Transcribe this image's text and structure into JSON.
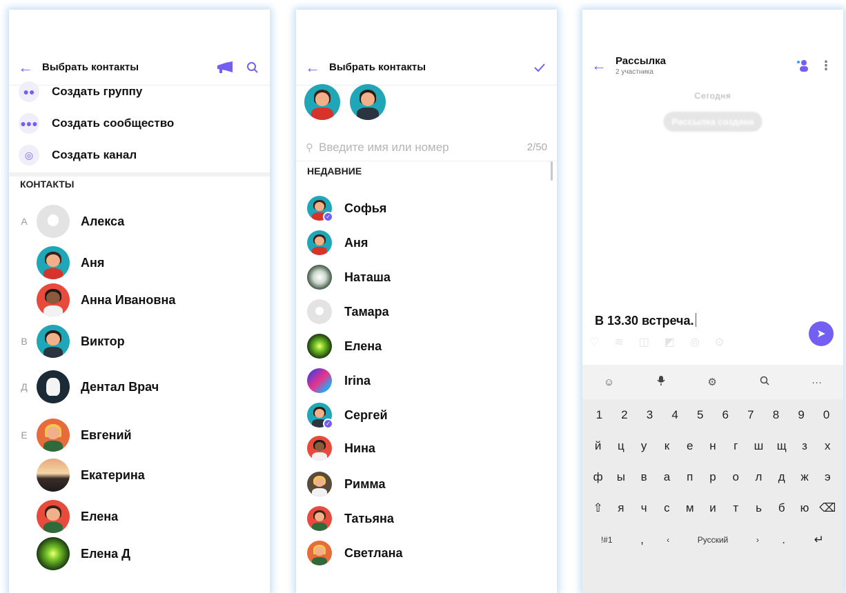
{
  "screen1": {
    "header": {
      "title": "Выбрать контакты",
      "back_icon": "arrow-left-icon",
      "broadcast_icon": "megaphone-icon",
      "search_icon": "search-icon"
    },
    "actions": [
      {
        "label": "Создать группу",
        "icon": "group-icon"
      },
      {
        "label": "Создать сообщество",
        "icon": "community-icon"
      },
      {
        "label": "Создать канал",
        "icon": "channel-icon"
      }
    ],
    "section_title": "КОНТАКТЫ",
    "contacts": [
      {
        "letter": "А",
        "name": "Алекса"
      },
      {
        "letter": "",
        "name": "Аня"
      },
      {
        "letter": "",
        "name": "Анна Ивановна"
      },
      {
        "letter": "В",
        "name": "Виктор"
      },
      {
        "letter": "Д",
        "name": "Дентал Врач"
      },
      {
        "letter": "Е",
        "name": "Евгений"
      },
      {
        "letter": "",
        "name": "Екатерина"
      },
      {
        "letter": "",
        "name": "Елена"
      },
      {
        "letter": "",
        "name": "Елена Д"
      }
    ]
  },
  "screen2": {
    "header": {
      "title": "Выбрать контакты",
      "back_icon": "arrow-left-icon",
      "confirm_icon": "check-icon"
    },
    "search": {
      "placeholder": "Введите имя или номер",
      "counter": "2/50"
    },
    "section_title": "НЕДАВНИЕ",
    "recent": [
      {
        "name": "Софья",
        "selected": true
      },
      {
        "name": "Аня",
        "selected": false
      },
      {
        "name": "Наташа",
        "selected": false
      },
      {
        "name": "Тамара",
        "selected": false
      },
      {
        "name": "Елена",
        "selected": false
      },
      {
        "name": "Irina",
        "selected": false
      },
      {
        "name": "Сергей",
        "selected": true
      },
      {
        "name": "Нина",
        "selected": false
      },
      {
        "name": "Римма",
        "selected": false
      },
      {
        "name": "Татьяна",
        "selected": false
      },
      {
        "name": "Светлана",
        "selected": false
      }
    ]
  },
  "screen3": {
    "header": {
      "title": "Рассылка",
      "subtitle": "2 участника",
      "back_icon": "arrow-left-icon",
      "add_participant_icon": "add-person-icon",
      "menu_icon": "more-vertical-icon"
    },
    "date_label": "Сегодня",
    "system_message": "Рассылка создана",
    "compose_text": "В 13.30 встреча.",
    "keyboard": {
      "top": [
        "☺",
        "🎙",
        "⚙",
        "🔍",
        "···"
      ],
      "numbers": [
        "1",
        "2",
        "3",
        "4",
        "5",
        "6",
        "7",
        "8",
        "9",
        "0"
      ],
      "row1": [
        "й",
        "ц",
        "у",
        "к",
        "е",
        "н",
        "г",
        "ш",
        "щ",
        "з",
        "х"
      ],
      "row2": [
        "ф",
        "ы",
        "в",
        "а",
        "п",
        "р",
        "о",
        "л",
        "д",
        "ж",
        "э"
      ],
      "row3": [
        "я",
        "ч",
        "с",
        "м",
        "и",
        "т",
        "ь",
        "б",
        "ю"
      ],
      "symbols_key": "!#1",
      "comma_key": ",",
      "lang_label": "Русский",
      "period_key": "."
    }
  },
  "colors": {
    "accent": "#7360f2"
  }
}
